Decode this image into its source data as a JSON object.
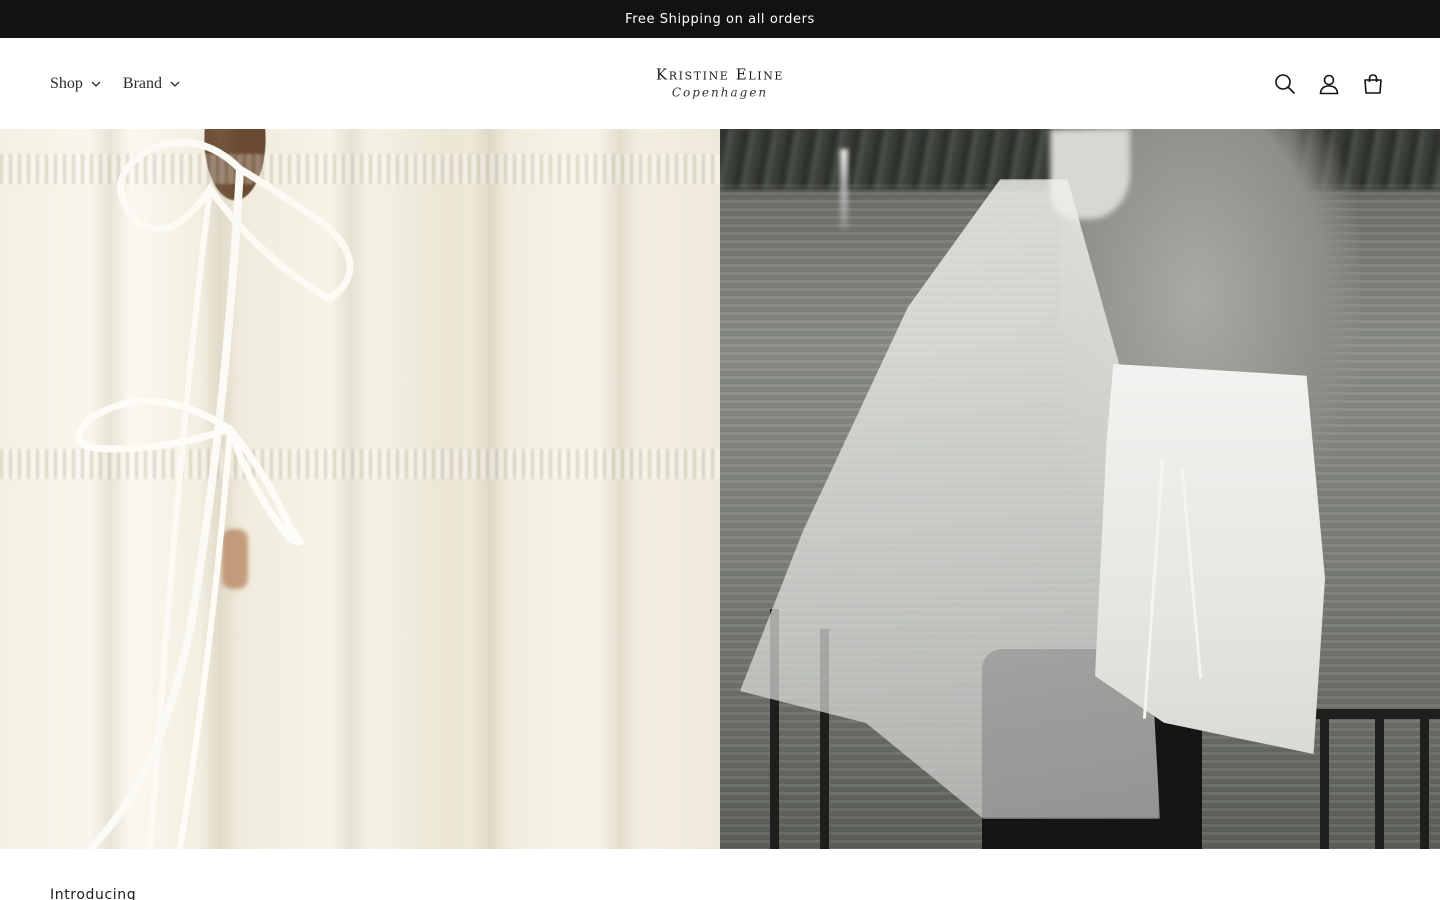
{
  "announcement": {
    "text": "Free Shipping on all orders"
  },
  "header": {
    "nav": [
      {
        "label": "Shop"
      },
      {
        "label": "Brand"
      }
    ],
    "logo": {
      "name": "Kristine Eline",
      "sub": "Copenhagen"
    },
    "icons": [
      "search-icon",
      "account-icon",
      "cart-icon"
    ]
  },
  "hero": {
    "left_image": "cream-drawstring-top-closeup",
    "right_image": "model-lakeside-black-and-white"
  },
  "section": {
    "heading": "Introducing"
  }
}
